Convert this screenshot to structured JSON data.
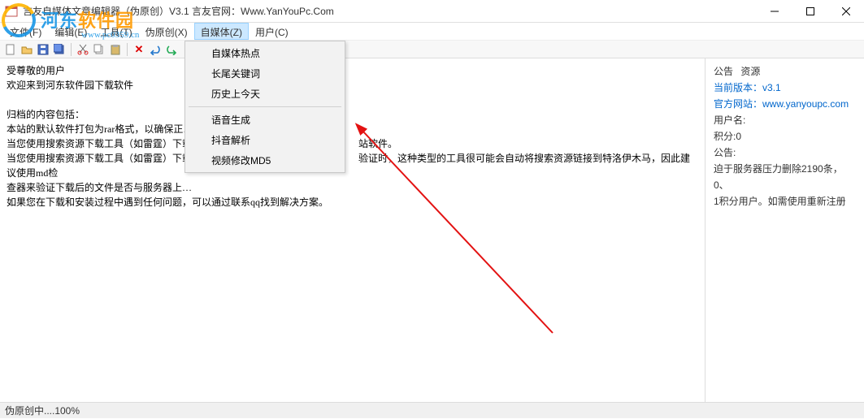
{
  "title": "言友自媒体文章编辑器（伪原创）V3.1 言友官网：Www.YanYouPc.Com",
  "menubar": {
    "file": "文件(F)",
    "edit": "编辑(E)",
    "tools": "工具(T)",
    "pseudo": "伪原创(X)",
    "media": "自媒体(Z)",
    "user": "用户(C)"
  },
  "dropdown": {
    "hot": "自媒体热点",
    "longtail": "长尾关键词",
    "history": "历史上今天",
    "voice": "语音生成",
    "douyin": "抖音解析",
    "videomd5": "视频修改MD5"
  },
  "editor": {
    "l1": "受尊敬的用户",
    "l2": "欢迎来到河东软件园下载软件",
    "l3": "归档的内容包括：",
    "l4": "本站的默认软件打包为rar格式，以确保正…",
    "l5a": "当您使用搜索资源下载工具（如雷霆）下载",
    "l5b": "站软件。",
    "l6a": "当您使用搜索资源下载工具（如雷霆）下载",
    "l6b": "验证时，这种类型的工具很可能会自动将搜索资源链接到特洛伊木马，因此建议使用md检",
    "l7": "查器来验证下载后的文件是否与服务器上…",
    "l8": "如果您在下载和安装过程中遇到任何问题，可以通过联系qq找到解决方案。"
  },
  "side": {
    "tab1": "公告",
    "tab2": "资源",
    "ver_label": "当前版本：",
    "ver_value": "v3.1",
    "site_label": "官方网站：",
    "site_value": "www.yanyoupc.com",
    "user_label": "用户名:",
    "score_label": "积分:",
    "score_value": "0",
    "notice_label": "公告:",
    "notice_1": "迫于服务器压力删除2190条，0、",
    "notice_2": "1积分用户。如需使用重新注册"
  },
  "status": "伪原创中....100%",
  "watermark": {
    "brand1a": "河东",
    "brand1b": "软件园",
    "brand2": "www.pc0359.cn"
  }
}
